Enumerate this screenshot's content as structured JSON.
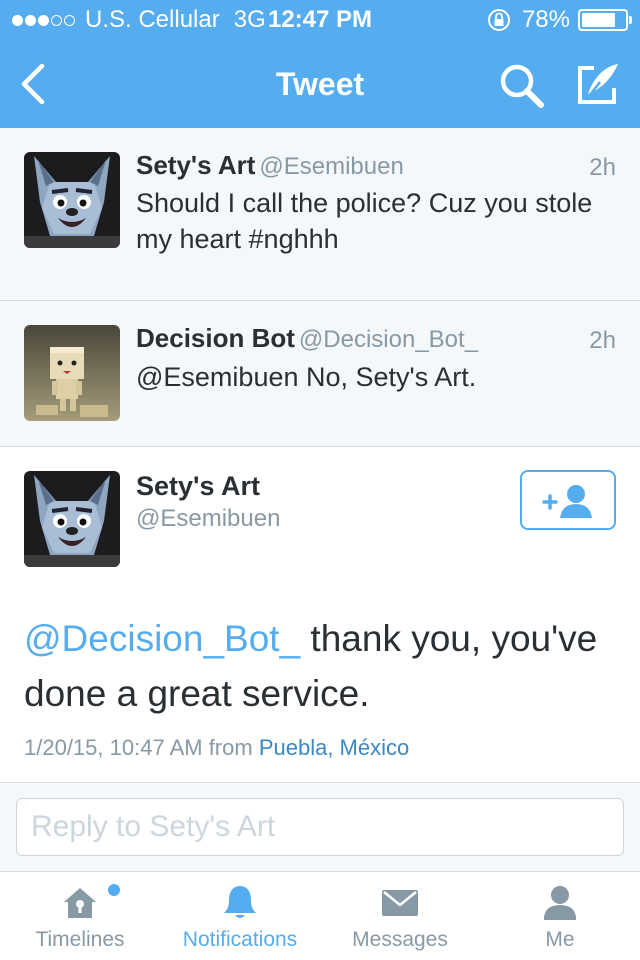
{
  "status_bar": {
    "carrier": "U.S. Cellular",
    "network": "3G",
    "time": "12:47 PM",
    "battery": "78%",
    "battery_level": 0.78
  },
  "nav": {
    "title": "Tweet",
    "icons": [
      "back-chevron-icon",
      "search-icon",
      "compose-icon"
    ]
  },
  "tweets": [
    {
      "name": "Sety's Art",
      "handle": "@Esemibuen",
      "time": "2h",
      "text": "Should I call the police? Cuz you stole my heart #nghhh"
    },
    {
      "name": "Decision Bot",
      "handle": "@Decision_Bot_",
      "time": "2h",
      "text": "@Esemibuen No, Sety's Art."
    }
  ],
  "detail": {
    "name": "Sety's Art",
    "handle": "@Esemibuen",
    "mention": "@Decision_Bot_",
    "text": " thank you, you've done a great service.",
    "timestamp": "1/20/15, 10:47 AM from ",
    "location": "Puebla, México",
    "follow_icon": "add-user-icon"
  },
  "reply": {
    "placeholder": "Reply to Sety's Art"
  },
  "tabs": [
    {
      "label": "Timelines",
      "icon": "home-icon"
    },
    {
      "label": "Notifications",
      "icon": "bell-icon"
    },
    {
      "label": "Messages",
      "icon": "envelope-icon"
    },
    {
      "label": "Me",
      "icon": "person-icon"
    }
  ],
  "colors": {
    "accent": "#55acee",
    "link": "#3b88c3",
    "muted": "#8899a6",
    "text": "#292f33"
  }
}
